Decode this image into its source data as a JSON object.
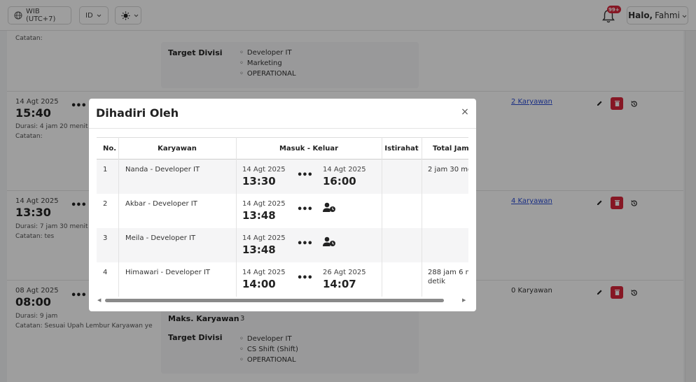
{
  "topbar": {
    "timezone": "WIB (UTC+7)",
    "language": "ID",
    "notif_badge": "99+",
    "greeting": "Halo,",
    "user_name": "Fahmi"
  },
  "background": {
    "top_note_label": "Catatan:",
    "row0_target_label": "Target Divisi",
    "row0_targets": [
      "Developer IT",
      "Marketing",
      "OPERATIONAL"
    ],
    "rows": [
      {
        "date": "14 Agt 2025",
        "time": "15:40",
        "duration": "Durasi: 4 jam 20 menit",
        "note": "Catatan:",
        "karyawan": "2 Karyawan"
      },
      {
        "date": "14 Agt 2025",
        "time": "13:30",
        "duration": "Durasi: 7 jam 30 menit",
        "note": "Catatan: tes",
        "karyawan": "4 Karyawan"
      },
      {
        "date": "08 Agt 2025",
        "time": "08:00",
        "duration": "Durasi: 9 jam",
        "note": "Catatan: Sesuai Upah Lembur Karyawan ye",
        "karyawan": "0 Karyawan"
      }
    ],
    "row3_max_label": "Maks. Karyawan",
    "row3_max_value": "3",
    "row3_target_label": "Target Divisi",
    "row3_targets": [
      "Developer IT",
      "CS Shift (Shift)",
      "OPERATIONAL"
    ]
  },
  "modal": {
    "title": "Dihadiri Oleh",
    "close": "×",
    "headers": [
      "No.",
      "Karyawan",
      "Masuk - Keluar",
      "Istirahat",
      "Total Jam K"
    ],
    "rows": [
      {
        "no": "1",
        "name": "Nanda - Developer IT",
        "in_date": "14 Agt 2025",
        "in_time": "13:30",
        "out_date": "14 Agt 2025",
        "out_time": "16:00",
        "rest": "",
        "total": "2 jam 30 men",
        "total2": ""
      },
      {
        "no": "2",
        "name": "Akbar - Developer IT",
        "in_date": "14 Agt 2025",
        "in_time": "13:48",
        "out_date": "",
        "out_time": "",
        "rest": "",
        "total": "",
        "total2": ""
      },
      {
        "no": "3",
        "name": "Meila - Developer IT",
        "in_date": "14 Agt 2025",
        "in_time": "13:48",
        "out_date": "",
        "out_time": "",
        "rest": "",
        "total": "",
        "total2": ""
      },
      {
        "no": "4",
        "name": "Himawari - Developer IT",
        "in_date": "14 Agt 2025",
        "in_time": "14:00",
        "out_date": "26 Agt 2025",
        "out_time": "14:07",
        "rest": "",
        "total": "288 jam 6 me",
        "total2": "detik"
      }
    ]
  },
  "icons": {
    "globe": "globe-icon",
    "theme": "sun-icon",
    "bell": "bell-icon",
    "edit": "pencil-icon",
    "delete": "trash-icon",
    "history": "history-icon",
    "pending_user": "user-clock-icon"
  },
  "colors": {
    "danger": "#d9263a",
    "link": "#2b4cd6"
  }
}
